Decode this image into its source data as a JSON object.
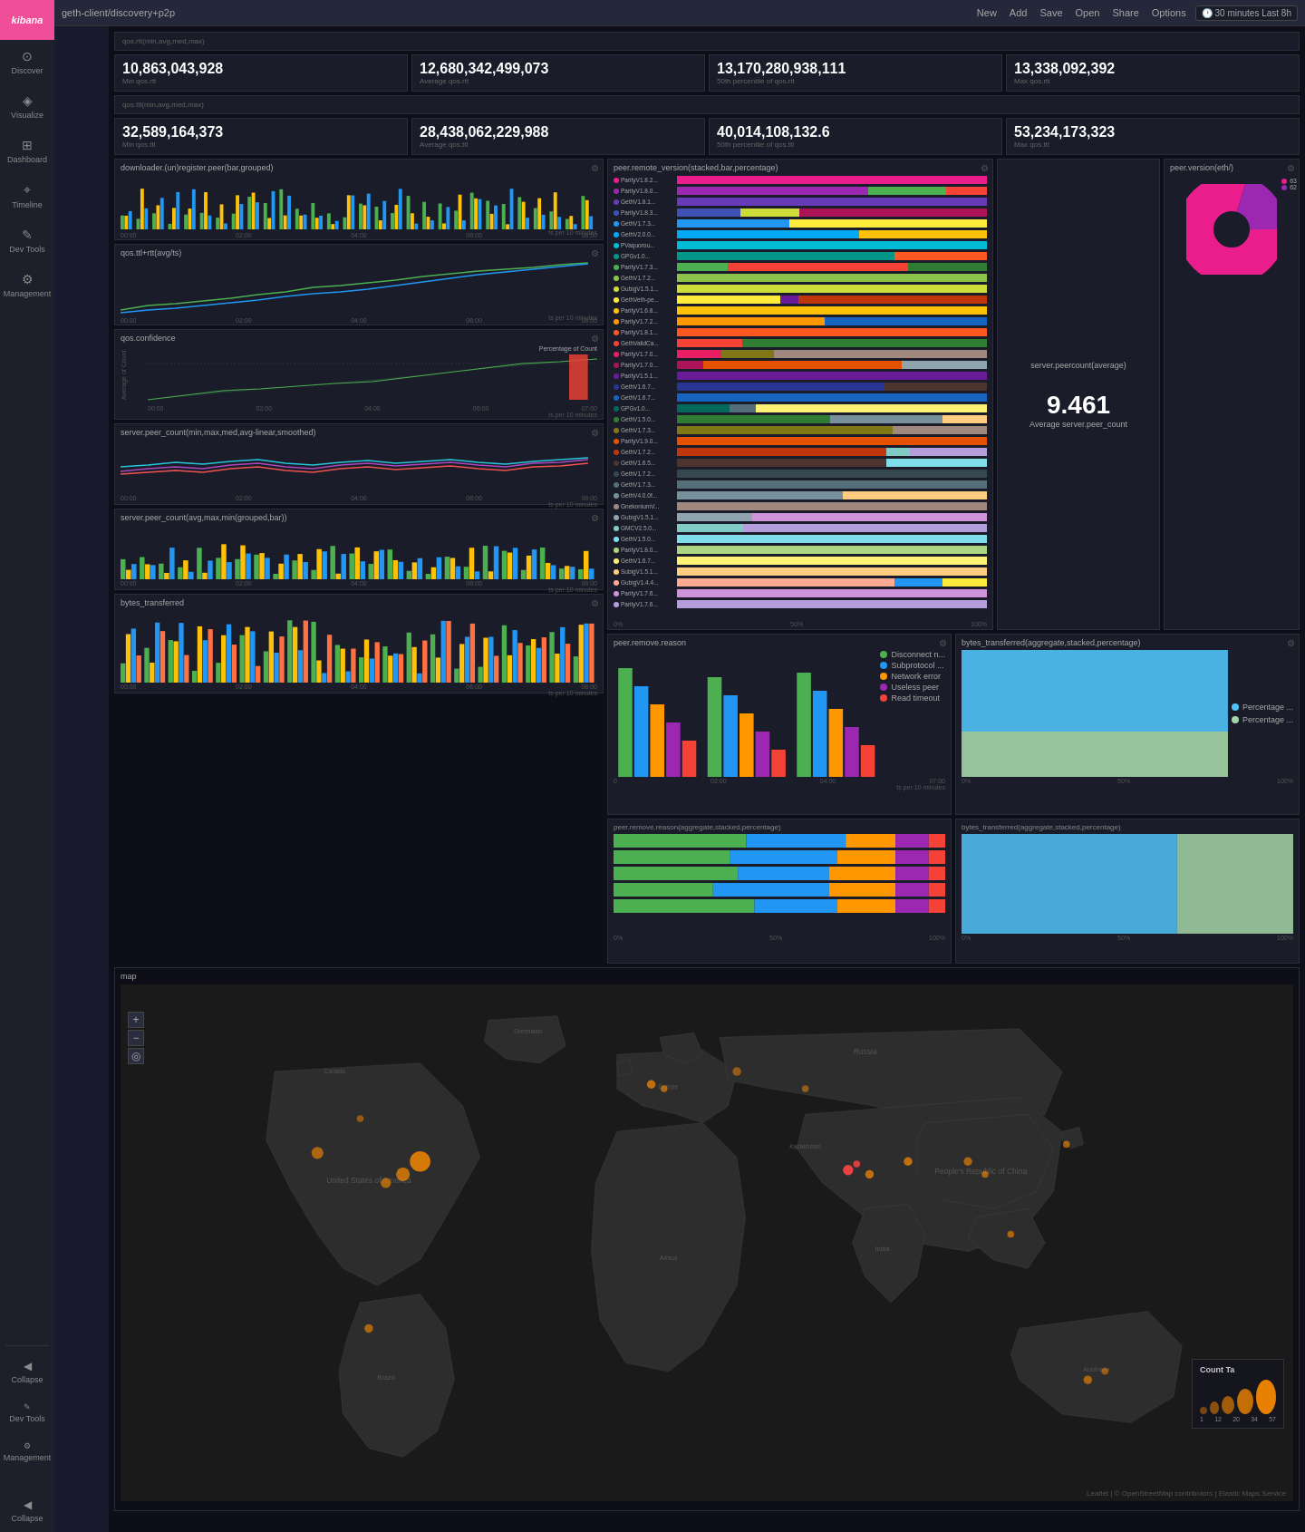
{
  "app": {
    "title": "kibana",
    "path": "geth-client/discovery+p2p"
  },
  "topbar": {
    "actions": [
      "New",
      "Add",
      "Save",
      "Open",
      "Share",
      "Options"
    ],
    "time": "30 minutes",
    "last": "Last 8h"
  },
  "sidebar": {
    "items": [
      {
        "label": "Discover",
        "icon": "⊙"
      },
      {
        "label": "Visualize",
        "icon": "◈"
      },
      {
        "label": "Dashboard",
        "icon": "⊞"
      },
      {
        "label": "Timeline",
        "icon": "⌖"
      },
      {
        "label": "Dev Tools",
        "icon": "✎"
      },
      {
        "label": "Management",
        "icon": "⚙"
      }
    ],
    "collapse_label": "Collapse"
  },
  "stats_rtt": {
    "title": "qos.rtt(min,avg,med,max)",
    "values": [
      {
        "value": "10,863,043,928",
        "label": "Min qos.rtt"
      },
      {
        "value": "12,680,342,499,073",
        "label": "Average qos.rtt"
      },
      {
        "value": "13,170,280,938,111",
        "label": "50th percentile of qos.rtt"
      },
      {
        "value": "13,338,092,392",
        "label": "Max qos.rtt"
      }
    ]
  },
  "stats_ttl": {
    "title": "qos.ttl(min,avg,med,max)",
    "values": [
      {
        "value": "32,589,164,373",
        "label": "Min qos.ttl"
      },
      {
        "value": "28,438,062,229,988",
        "label": "Average qos.ttl"
      },
      {
        "value": "40,014,108,132.6",
        "label": "50th percentile of qos.ttl"
      },
      {
        "value": "53,234,173,323",
        "label": "Max qos.ttl"
      }
    ]
  },
  "charts": {
    "downloader_title": "downloader.(un)register.peer(bar,grouped)",
    "qos_rtt_title": "qos.ttl+rtt(avg/ts)",
    "qos_confidence_title": "qos.confidence",
    "server_peer_count_title": "server.peer_count(min,max,med,avg-linear,smoothed)",
    "server_peer_count_bar_title": "server.peer_count(avg,max,min(grouped,bar))",
    "bytes_transferred_title": "bytes_transferred"
  },
  "peer_remote": {
    "title": "peer.remote_version(stacked,bar,percentage)",
    "versions": [
      "ParityV1.8.2...",
      "ParityV1.8.0...",
      "GethV1.8.1...",
      "ParityV1.8.3...",
      "GethV1.7.3...",
      "GethV2.0.0...",
      "PVaquorou...",
      "GPGv1.0...",
      "ParityV1.7.3...",
      "GethV1.7.2...",
      "GubigV1.5.1...",
      "GethVeth-pe...",
      "ParityV1.6.8...",
      "ParityV1.7.2...",
      "ParityV1.8.1...",
      "GethValidCa...",
      "ParityV1.7.0...",
      "ParityV1.7.0...",
      "ParityV1.5.1...",
      "GethV1.6.7...",
      "GethV1.6.7...",
      "GPGv1.0...",
      "GethV1.5.0...",
      "GethV1.7.3...",
      "ParityV1.9.0...",
      "GethV1.7.2...",
      "GethV1.6.5...",
      "GethV1.7.2...",
      "GethV1.7.3...",
      "GethV4.0.0f...",
      "GnekoniumV...",
      "GubigV1.5.1...",
      "GMCV2.5.0...",
      "GethV1.5.0...",
      "ParityV1.8.0...",
      "GethV1.6.7...",
      "SubigV1.5.1...",
      "GubigV1.4.4...",
      "ParityV1.7.6...",
      "ParityV1.7.6..."
    ]
  },
  "server_peer": {
    "title": "server.peercount(average)",
    "value": "9.461",
    "label": "Average server.peer_count"
  },
  "peer_version_eth": {
    "title": "peer.version(eth/)",
    "legend": [
      {
        "label": "63",
        "color": "#e91e8c"
      },
      {
        "label": "62",
        "color": "#9c27b0"
      }
    ]
  },
  "remove_reason": {
    "title": "peer.remove.reason",
    "legend": [
      {
        "label": "Disconnect n...",
        "color": "#4caf50"
      },
      {
        "label": "Subprotocol ...",
        "color": "#2196f3"
      },
      {
        "label": "Network error",
        "color": "#ff9800"
      },
      {
        "label": "Useless peer",
        "color": "#9c27b0"
      },
      {
        "label": "Read timeout",
        "color": "#f44336"
      }
    ]
  },
  "bytes_transferred_legend": {
    "title": "bytes_transferred(aggregate,stacked,percentage)",
    "items": [
      {
        "label": "Percentage ...",
        "color": "#4fc3f7"
      },
      {
        "label": "Percentage ...",
        "color": "#a5d6a7"
      }
    ]
  },
  "map": {
    "title": "map",
    "attribution": "Leaflet | © OpenStreetMap contributors | Elastic Maps Service"
  },
  "count_legend": {
    "title": "Count Ta",
    "items": [
      {
        "value": "1",
        "label": ""
      },
      {
        "value": "12",
        "label": ""
      },
      {
        "value": "20",
        "label": ""
      },
      {
        "value": "34",
        "label": ""
      },
      {
        "value": "57",
        "label": ""
      }
    ]
  }
}
